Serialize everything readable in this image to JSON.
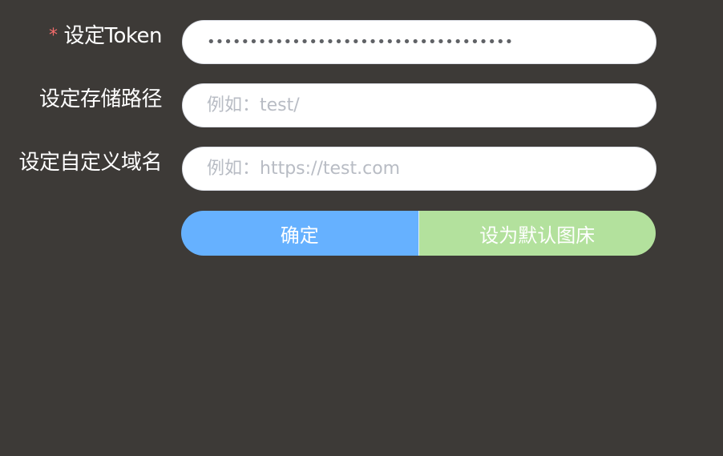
{
  "form": {
    "token": {
      "label": "设定Token",
      "required_mark": "*",
      "value": "************************************"
    },
    "storage_path": {
      "label": "设定存储路径",
      "placeholder": "例如：test/"
    },
    "custom_domain": {
      "label": "设定自定义域名",
      "placeholder": "例如：https://test.com"
    }
  },
  "actions": {
    "confirm_label": "确定",
    "set_default_label": "设为默认图床"
  },
  "colors": {
    "background": "#3d3a37",
    "confirm_button": "#66b1ff",
    "default_button": "#b3e19d",
    "required_mark": "#f56c6c"
  }
}
